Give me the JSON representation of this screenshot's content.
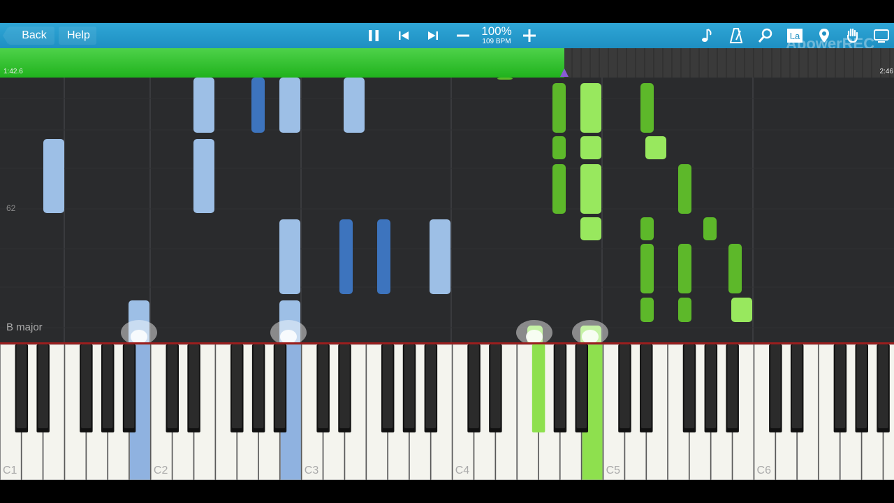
{
  "toolbar": {
    "back_label": "Back",
    "help_label": "Help",
    "tempo_percent": "100%",
    "tempo_bpm": "109 BPM",
    "icons_center": [
      "pause-icon",
      "skip-back-icon",
      "skip-forward-icon",
      "minus-icon",
      "plus-icon"
    ],
    "icons_right": [
      "music-note-icon",
      "metronome-icon",
      "search-icon",
      "label-icon",
      "location-pin-icon",
      "hand-icon",
      "screen-cast-icon"
    ],
    "label_icon_text": "La"
  },
  "watermark": "ApowerREC",
  "progress": {
    "current_time": "1:42.6",
    "total_time": "2:46",
    "fraction": 0.62,
    "fill_color": "#2ec22a"
  },
  "roll": {
    "note_label": "62",
    "key_signature": "B major",
    "colors": {
      "left_hand_light": "#9dbfe6",
      "left_hand_dark": "#3d74be",
      "right_hand_light": "#98e85e",
      "right_hand_dark": "#5db82a"
    }
  },
  "keyboard": {
    "octave_labels": [
      "C1",
      "C2",
      "C3",
      "C4",
      "C5",
      "C6"
    ],
    "pressed_color_blue": "#8fb2e0",
    "pressed_color_green": "#8ee04e"
  }
}
